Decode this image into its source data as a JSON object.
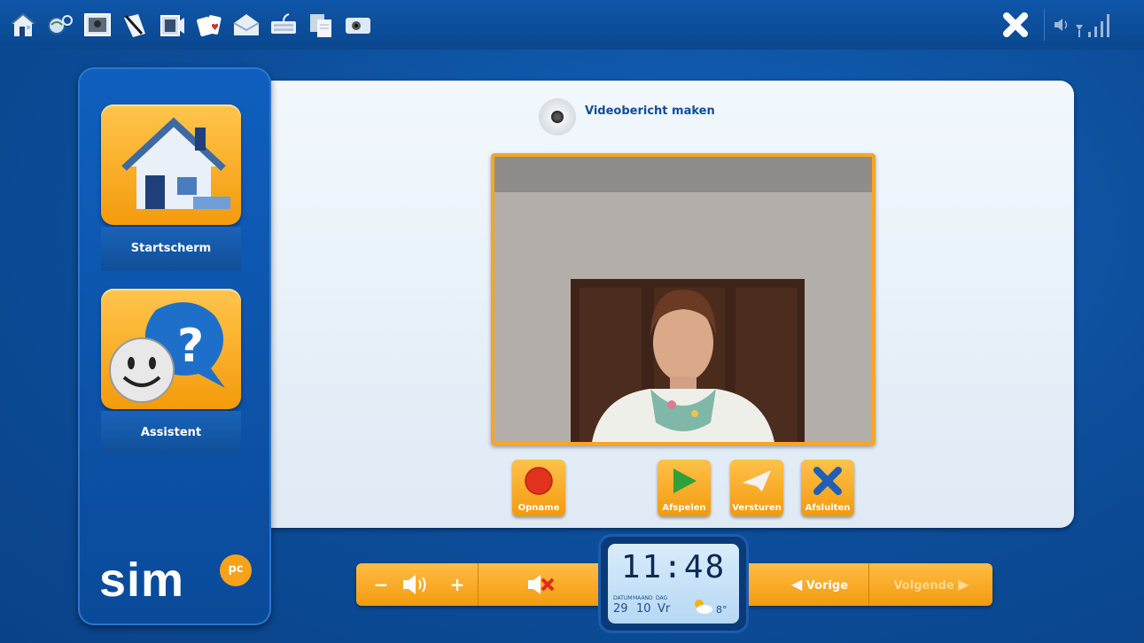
{
  "topbar": {
    "icons": [
      "home-icon",
      "search-globe-icon",
      "photo-icon",
      "pen-icon",
      "video-icon",
      "cards-icon",
      "mail-icon",
      "keyboard-icon",
      "documents-icon",
      "webcam-icon"
    ]
  },
  "sidebar": {
    "items": [
      {
        "label": "Startscherm"
      },
      {
        "label": "Assistent"
      }
    ],
    "logo": "sim",
    "logo_badge": "pc"
  },
  "panel": {
    "title": "Videobericht maken"
  },
  "controls": [
    {
      "label": "Opname"
    },
    {
      "label": "Afspelen"
    },
    {
      "label": "Versturen"
    },
    {
      "label": "Afsluiten"
    }
  ],
  "bottombar": {
    "vol_minus": "−",
    "vol_plus": "+",
    "prev": "Vorige",
    "next": "Volgende"
  },
  "clock": {
    "time": "11:48",
    "label_date": "DATUM",
    "label_month": "MAAND",
    "label_day": "DAG",
    "date": "29",
    "month": "10",
    "day": "Vr",
    "temperature": "8°"
  },
  "colors": {
    "background": "#0d4f9c",
    "accent": "#f39a0e"
  }
}
